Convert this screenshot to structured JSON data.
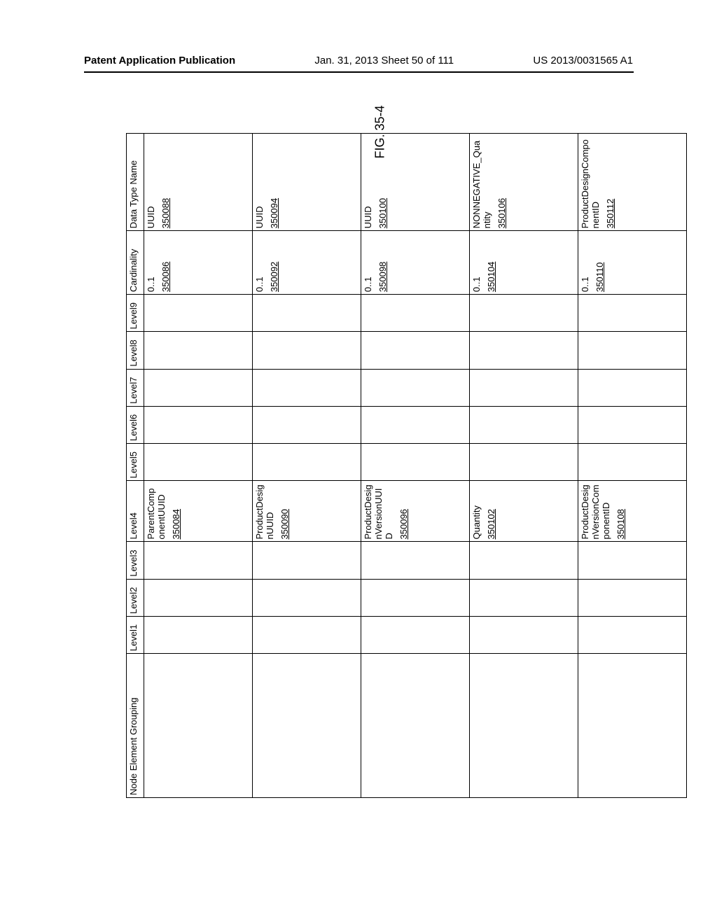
{
  "header": {
    "left": "Patent Application Publication",
    "mid": "Jan. 31, 2013  Sheet 50 of 111",
    "right": "US 2013/0031565 A1"
  },
  "figure_label": "FIG. 35-4",
  "columns": [
    "Node Element Grouping",
    "Level1",
    "Level2",
    "Level3",
    "Level4",
    "Level5",
    "Level6",
    "Level7",
    "Level8",
    "Level9",
    "Cardinality",
    "Data Type Name"
  ],
  "rows": [
    {
      "level4_text": "ParentComponentUUID",
      "level4_ref": "350084",
      "cardinality_text": "0..1",
      "cardinality_ref": "350086",
      "dtn_text": "UUID",
      "dtn_ref": "350088"
    },
    {
      "level4_text": "ProductDesignUUID",
      "level4_ref": "350090",
      "cardinality_text": "0..1",
      "cardinality_ref": "350092",
      "dtn_text": "UUID",
      "dtn_ref": "350094"
    },
    {
      "level4_text": "ProductDesignVersionUUID",
      "level4_ref": "350096",
      "cardinality_text": "0..1",
      "cardinality_ref": "350098",
      "dtn_text": "UUID",
      "dtn_ref": "350100"
    },
    {
      "level4_text": "Quantity",
      "level4_ref": "350102",
      "cardinality_text": "0..1",
      "cardinality_ref": "350104",
      "dtn_text": "NONNEGATIVE_Quantity",
      "dtn_ref": "350106"
    },
    {
      "level4_text": "ProductDesignVersionComponentID",
      "level4_ref": "350108",
      "cardinality_text": "0..1",
      "cardinality_ref": "350110",
      "dtn_text": "ProductDesignComponentID",
      "dtn_ref": "350112"
    }
  ]
}
